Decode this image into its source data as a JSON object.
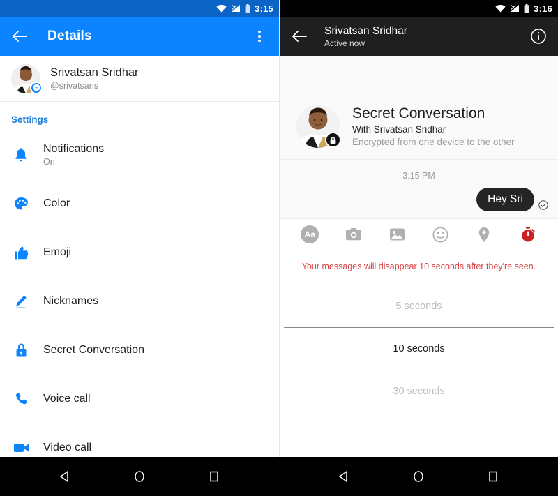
{
  "left": {
    "status_bar": {
      "time": "3:15",
      "icons": [
        "wifi-icon",
        "cell-signal-off-icon",
        "battery-icon"
      ]
    },
    "appbar": {
      "title": "Details",
      "back_icon": "back-arrow-icon",
      "overflow_icon": "overflow-menu-icon"
    },
    "profile": {
      "name": "Srivatsan Sridhar",
      "handle": "@srivatsans",
      "badge": "messenger-badge-icon"
    },
    "section_label": "Settings",
    "items": [
      {
        "label": "Notifications",
        "sub": "On",
        "icon": "bell-icon"
      },
      {
        "label": "Color",
        "sub": "",
        "icon": "palette-icon"
      },
      {
        "label": "Emoji",
        "sub": "",
        "icon": "thumbs-up-icon"
      },
      {
        "label": "Nicknames",
        "sub": "",
        "icon": "pencil-icon"
      },
      {
        "label": "Secret Conversation",
        "sub": "",
        "icon": "lock-icon"
      },
      {
        "label": "Voice call",
        "sub": "",
        "icon": "phone-icon"
      },
      {
        "label": "Video call",
        "sub": "",
        "icon": "video-camera-icon"
      }
    ]
  },
  "right": {
    "status_bar": {
      "time": "3:16",
      "icons": [
        "wifi-icon",
        "cell-signal-off-icon",
        "battery-icon"
      ]
    },
    "appbar": {
      "name": "Srivatsan Sridhar",
      "status": "Active now",
      "back_icon": "back-arrow-icon",
      "info_icon": "info-icon"
    },
    "secret_card": {
      "title": "Secret Conversation",
      "with": "With Srivatsan Sridhar",
      "encrypted": "Encrypted from one device to the other",
      "badge": "lock-badge-icon"
    },
    "conversation": {
      "timestamp": "3:15 PM",
      "message": "Hey Sri",
      "receipt": "delivered-check-icon"
    },
    "composer": [
      {
        "icon": "text-format-aa-icon",
        "label": "Aa"
      },
      {
        "icon": "camera-icon",
        "label": ""
      },
      {
        "icon": "photo-library-icon",
        "label": ""
      },
      {
        "icon": "emoji-smiley-icon",
        "label": ""
      },
      {
        "icon": "location-pin-icon",
        "label": ""
      },
      {
        "icon": "disappearing-timer-icon",
        "label": ""
      }
    ],
    "notice": "Your messages will disappear 10 seconds after they're seen.",
    "timer_picker": {
      "options": [
        "5 seconds",
        "10 seconds",
        "30 seconds"
      ],
      "selected_index": 1
    }
  },
  "navbar": {
    "buttons": [
      "back-nav-icon",
      "home-nav-icon",
      "recents-nav-icon"
    ]
  },
  "colors": {
    "messenger_blue": "#0d84ff",
    "status_blue": "#0b63c5",
    "dark_header": "#1f1f1f",
    "notice_red": "#d94242",
    "timer_red": "#cc2127"
  }
}
